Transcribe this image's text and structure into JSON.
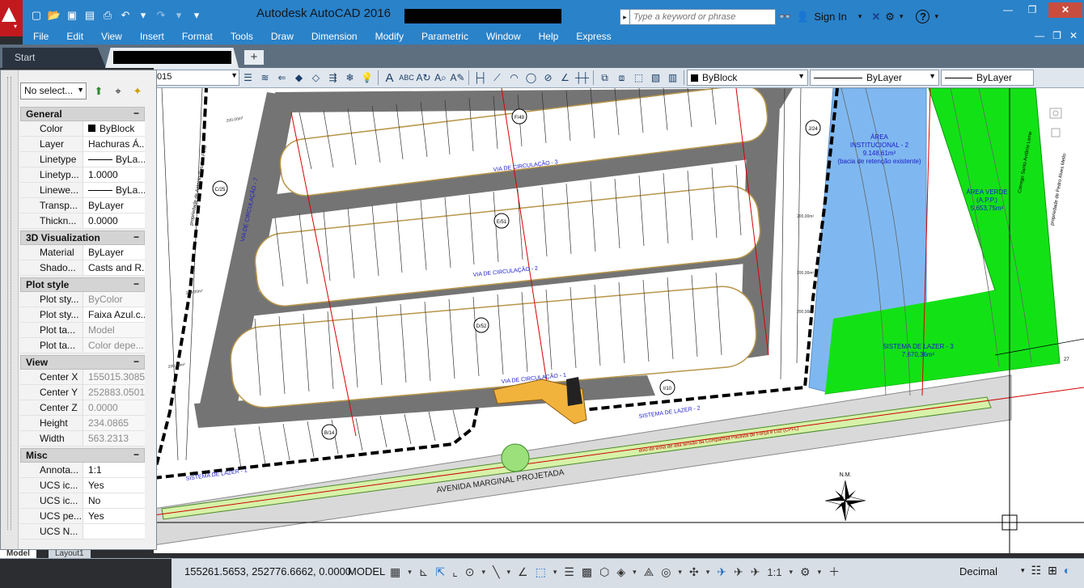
{
  "titlebar": {
    "app_title": "Autodesk AutoCAD 2016",
    "search_placeholder": "Type a keyword or phrase",
    "sign_in": "Sign In"
  },
  "menu": [
    "File",
    "Edit",
    "View",
    "Insert",
    "Format",
    "Tools",
    "Draw",
    "Dimension",
    "Modify",
    "Parametric",
    "Window",
    "Help",
    "Express"
  ],
  "tabs": {
    "start": "Start",
    "new_tab": "+"
  },
  "ribbon": {
    "layer_value": "015",
    "color_value": "ByBlock",
    "linetype_value": "ByLayer",
    "lineweight_value": "ByLayer"
  },
  "palette": {
    "selection": "No select...",
    "sections": [
      {
        "title": "General",
        "toggle": "−",
        "rows": [
          {
            "k": "Color",
            "v": "ByBlock",
            "swatch": true
          },
          {
            "k": "Layer",
            "v": "Hachuras Á..."
          },
          {
            "k": "Linetype",
            "v": "ByLa...",
            "line": true
          },
          {
            "k": "Linetyp...",
            "v": "1.0000"
          },
          {
            "k": "Linewe...",
            "v": "ByLa...",
            "line": true
          },
          {
            "k": "Transp...",
            "v": "ByLayer"
          },
          {
            "k": "Thickn...",
            "v": "0.0000"
          }
        ]
      },
      {
        "title": "3D Visualization",
        "toggle": "−",
        "rows": [
          {
            "k": "Material",
            "v": "ByLayer"
          },
          {
            "k": "Shado...",
            "v": "Casts and R..."
          }
        ]
      },
      {
        "title": "Plot style",
        "toggle": "−",
        "rows": [
          {
            "k": "Plot sty...",
            "v": "ByColor",
            "ro": true
          },
          {
            "k": "Plot sty...",
            "v": "Faixa Azul.c..."
          },
          {
            "k": "Plot ta...",
            "v": "Model",
            "ro": true
          },
          {
            "k": "Plot ta...",
            "v": "Color depe...",
            "ro": true
          }
        ]
      },
      {
        "title": "View",
        "toggle": "−",
        "rows": [
          {
            "k": "Center X",
            "v": "155015.3085",
            "ro": true
          },
          {
            "k": "Center Y",
            "v": "252883.0501",
            "ro": true
          },
          {
            "k": "Center Z",
            "v": "0.0000",
            "ro": true
          },
          {
            "k": "Height",
            "v": "234.0865",
            "ro": true
          },
          {
            "k": "Width",
            "v": "563.2313",
            "ro": true
          }
        ]
      },
      {
        "title": "Misc",
        "toggle": "−",
        "rows": [
          {
            "k": "Annota...",
            "v": "1:1"
          },
          {
            "k": "UCS ic...",
            "v": "Yes"
          },
          {
            "k": "UCS ic...",
            "v": "No"
          },
          {
            "k": "UCS pe...",
            "v": "Yes"
          },
          {
            "k": "UCS N...",
            "v": ""
          }
        ]
      }
    ]
  },
  "layout_tabs": [
    "Model",
    "Layout1"
  ],
  "drawing": {
    "labels": {
      "area_inst": "ÁREA",
      "area_inst2": "INSTITUCIONAL - 2",
      "area_inst_val": "9.148,61m²",
      "area_inst_note": "(bacia de retenção existente)",
      "area_verde": "ÁREA VERDE",
      "area_verde2": "(A.P.P.)",
      "area_verde_val": "5.653,75m²",
      "lazer3": "SISTEMA DE LAZER - 3",
      "lazer3_val": "7.670,36m²",
      "via1": "VIA DE CIRCULAÇÃO - 1",
      "via2": "VIA DE CIRCULAÇÃO - 2",
      "via3": "VIA DE CIRCULAÇÃO - 3",
      "via7": "VIA DE CIRCULAÇÃO - 7",
      "avenida": "AVENIDA MARGINAL PROJETADA",
      "lazer1": "SISTEMA DE LAZER - 1",
      "lazer2": "SISTEMA DE LAZER - 2",
      "linha_alta": "eixo de linha de alta tensão da Companhia Paulista de Força e Luz (CPFL)",
      "nm": "N.M.",
      "prop_left": "propriedade de Antonio Rosalvo Filho",
      "prop_right": "propriedade de Pedro Alves Mello",
      "corrego": "Córrego Santo Antônio Leme",
      "lot_area": "200,00m²",
      "marker27": "27"
    },
    "markers": [
      "F/49",
      "E/51",
      "D/52",
      "B/14",
      "C/25",
      "J/24",
      "I/10"
    ]
  },
  "statusbar": {
    "coords": "155261.5653, 252776.6662, 0.0000",
    "model": "MODEL",
    "scale": "1:1",
    "units": "Decimal"
  }
}
